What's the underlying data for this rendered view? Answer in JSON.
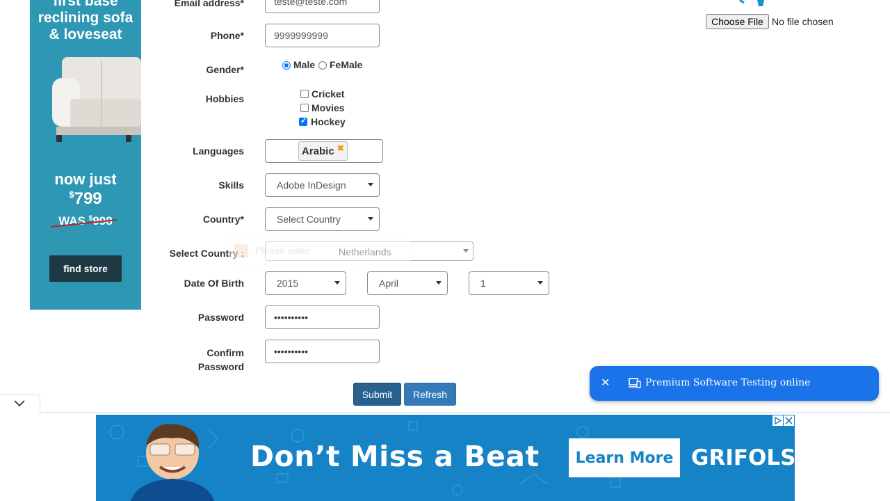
{
  "form": {
    "email": {
      "label": "Email address*",
      "value": "teste@teste.com"
    },
    "phone": {
      "label": "Phone*",
      "value": "9999999999"
    },
    "gender": {
      "label": "Gender*",
      "options": [
        "Male",
        "FeMale"
      ],
      "selected": "Male"
    },
    "hobbies": {
      "label": "Hobbies",
      "options": [
        "Cricket",
        "Movies",
        "Hockey"
      ],
      "checked": [
        "Hockey"
      ]
    },
    "languages": {
      "label": "Languages",
      "selected_tag": "Arabic",
      "remove_icon": "close-icon"
    },
    "skills": {
      "label": "Skills",
      "value": "Adobe InDesign"
    },
    "country": {
      "label": "Country*",
      "value": "Select Country"
    },
    "select_country": {
      "label": "Select Country :",
      "value": "Netherlands",
      "ghost_text": "Please select an item in the list."
    },
    "dob": {
      "label": "Date Of Birth",
      "year": "2015",
      "month": "April",
      "day": "1"
    },
    "password": {
      "label": "Password",
      "value": "••••••••••"
    },
    "confirm_password": {
      "label_line1": "Confirm",
      "label_line2": "Password",
      "value": "••••••••••"
    },
    "submit_label": "Submit",
    "refresh_label": "Refresh"
  },
  "file_upload": {
    "button_label": "Choose File",
    "status": "No file chosen"
  },
  "side_ad": {
    "headline_lines": [
      "first base",
      "reclining sofa",
      "& loveseat"
    ],
    "price_line1": "now just",
    "price_currency": "$",
    "price_value": "799",
    "was_label": "WAS",
    "was_currency": "$",
    "was_value": "998",
    "cta": "find store"
  },
  "popup": {
    "text": "Premium Software Testing online",
    "close_icon": "close-icon",
    "device_icon": "devices-icon"
  },
  "bottom_ad": {
    "headline": "Don’t Miss a Beat",
    "cta": "Learn More",
    "brand": "GRIFOLS"
  },
  "colors": {
    "primary_button": "#337ab7",
    "submit_button": "#286090",
    "popup_bg": "#1a73e8",
    "bottom_ad_bg": "#1683c6",
    "side_ad_bg": "#2e97b3"
  }
}
